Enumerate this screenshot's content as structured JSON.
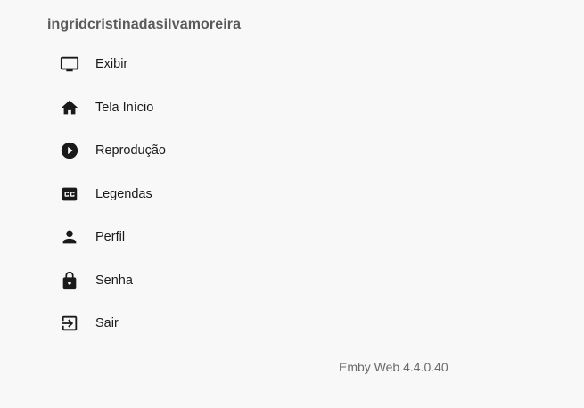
{
  "user": {
    "name": "ingridcristinadasilvamoreira"
  },
  "menu": {
    "items": [
      {
        "label": "Exibir",
        "icon": "tv-icon"
      },
      {
        "label": "Tela Início",
        "icon": "home-icon"
      },
      {
        "label": "Reprodução",
        "icon": "play-circle-icon"
      },
      {
        "label": "Legendas",
        "icon": "closed-caption-icon"
      },
      {
        "label": "Perfil",
        "icon": "person-icon"
      },
      {
        "label": "Senha",
        "icon": "lock-icon"
      },
      {
        "label": "Sair",
        "icon": "exit-icon"
      }
    ]
  },
  "footer": {
    "version": "Emby Web 4.4.0.40"
  }
}
